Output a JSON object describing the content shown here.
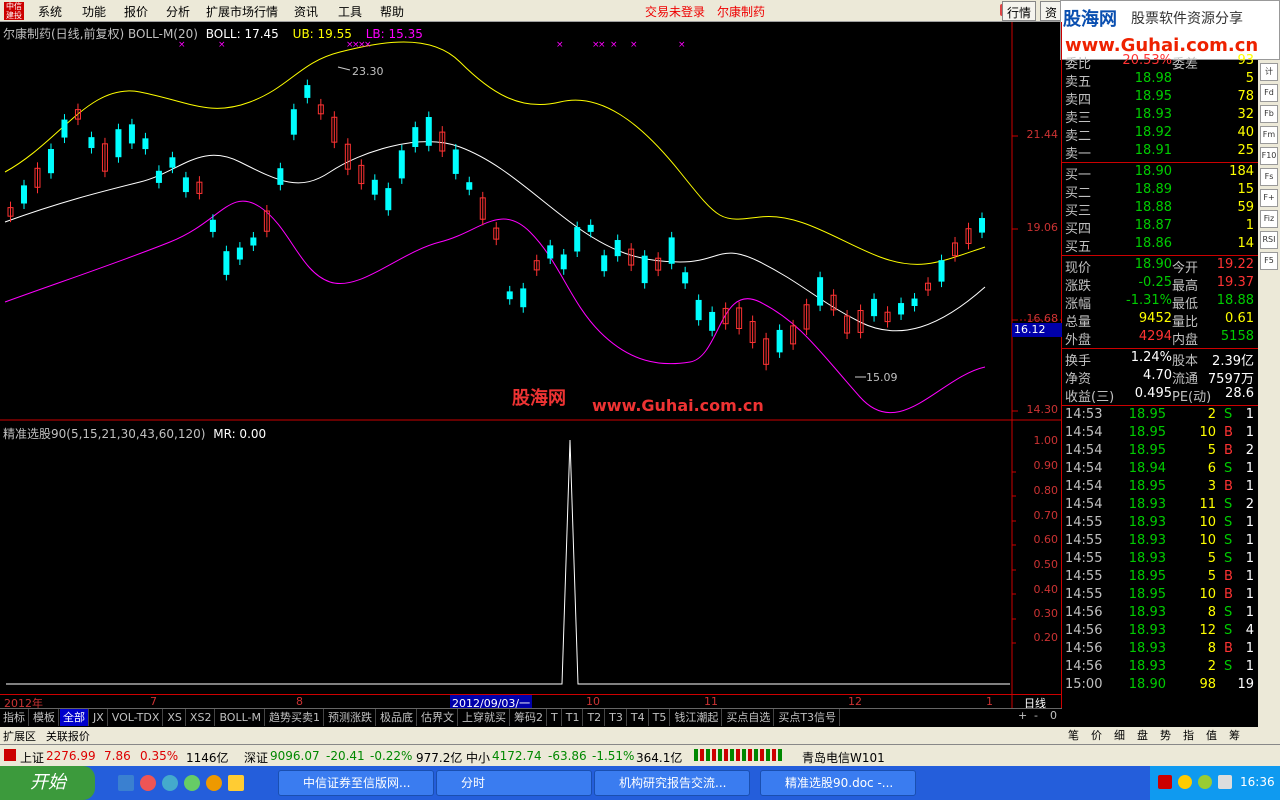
{
  "menu": {
    "items": [
      "系统",
      "功能",
      "报价",
      "分析",
      "扩展市场行情",
      "资讯",
      "工具",
      "帮助"
    ],
    "status_login": "交易未登录",
    "status_stock": "尔康制药",
    "btn_trade": "行情",
    "btn_info": "资"
  },
  "brand": {
    "line1": "股海网",
    "line2": "股票软件资源分享",
    "line3": "www.Guhai.com.cn"
  },
  "chart": {
    "info_title": "尔康制药(日线,前复权) BOLL-M(20)",
    "boll": "BOLL: 17.45",
    "ub": "UB: 19.55",
    "lb": "LB: 15.35",
    "price_ticks": [
      "21.44",
      "19.06",
      "16.68",
      "14.30"
    ],
    "current_tag": "16.12",
    "high_label": "23.30",
    "low_label": "15.09",
    "watermark_cn": "股海网",
    "watermark_url": "www.Guhai.com.cn",
    "ind_title": "精准选股90(5,15,21,30,43,60,120)",
    "ind_mr": "MR: 0.00",
    "ind_ticks": [
      "1.00",
      "0.90",
      "0.80",
      "0.70",
      "0.60",
      "0.50",
      "0.40",
      "0.30",
      "0.20"
    ],
    "date_labels": [
      "2012年",
      "7",
      "8",
      "2012/09/03/一",
      "10",
      "11",
      "12",
      "1"
    ],
    "period": "日线",
    "colors": {
      "up": "#ff3333",
      "down": "#00ffff",
      "ub": "#ffff00",
      "mid": "#ffffff",
      "lb": "#ff00ff",
      "signal": "#ffffff"
    }
  },
  "tabs": [
    "指标",
    "模板",
    "全部",
    "JX",
    "VOL-TDX",
    "XS",
    "XS2",
    "BOLL-M",
    "趋势买卖1",
    "预测涨跌",
    "极品底",
    "估界文",
    "上穿就买",
    "筹码2",
    "T",
    "T1",
    "T2",
    "T3",
    "T4",
    "T5",
    "钱江潮起",
    "买点自选",
    "买点T3信号"
  ],
  "subtabs": [
    "扩展区",
    "关联报价"
  ],
  "zoom": [
    "+",
    "-",
    "0"
  ],
  "quote": {
    "wei_bi_label": "委比",
    "wei_bi": "20.53%",
    "wei_cha_label": "委差",
    "wei_cha": "93",
    "sells": [
      {
        "l": "卖五",
        "p": "18.98",
        "v": "5"
      },
      {
        "l": "卖四",
        "p": "18.95",
        "v": "78"
      },
      {
        "l": "卖三",
        "p": "18.93",
        "v": "32"
      },
      {
        "l": "卖二",
        "p": "18.92",
        "v": "40"
      },
      {
        "l": "卖一",
        "p": "18.91",
        "v": "25"
      }
    ],
    "buys": [
      {
        "l": "买一",
        "p": "18.90",
        "v": "184"
      },
      {
        "l": "买二",
        "p": "18.89",
        "v": "15"
      },
      {
        "l": "买三",
        "p": "18.88",
        "v": "59"
      },
      {
        "l": "买四",
        "p": "18.87",
        "v": "1"
      },
      {
        "l": "买五",
        "p": "18.86",
        "v": "14"
      }
    ],
    "stats": [
      {
        "l1": "现价",
        "v1": "18.90",
        "l2": "今开",
        "v2": "19.22"
      },
      {
        "l1": "涨跌",
        "v1": "-0.25",
        "l2": "最高",
        "v2": "19.37"
      },
      {
        "l1": "涨幅",
        "v1": "-1.31%",
        "l2": "最低",
        "v2": "18.88"
      },
      {
        "l1": "总量",
        "v1": "9452",
        "l2": "量比",
        "v2": "0.61"
      },
      {
        "l1": "外盘",
        "v1": "4294",
        "l2": "内盘",
        "v2": "5158"
      }
    ],
    "stats2": [
      {
        "l1": "换手",
        "v1": "1.24%",
        "l2": "股本",
        "v2": "2.39亿"
      },
      {
        "l1": "净资",
        "v1": "4.70",
        "l2": "流通",
        "v2": "7597万"
      },
      {
        "l1": "收益(三)",
        "v1": "0.495",
        "l2": "PE(动)",
        "v2": "28.6"
      }
    ]
  },
  "ticks": [
    {
      "t": "14:53",
      "p": "18.95",
      "v": "2",
      "s": "S",
      "n": "1"
    },
    {
      "t": "14:54",
      "p": "18.95",
      "v": "10",
      "s": "B",
      "n": "1"
    },
    {
      "t": "14:54",
      "p": "18.95",
      "v": "5",
      "s": "B",
      "n": "2"
    },
    {
      "t": "14:54",
      "p": "18.94",
      "v": "6",
      "s": "S",
      "n": "1"
    },
    {
      "t": "14:54",
      "p": "18.95",
      "v": "3",
      "s": "B",
      "n": "1"
    },
    {
      "t": "14:54",
      "p": "18.93",
      "v": "11",
      "s": "S",
      "n": "2"
    },
    {
      "t": "14:55",
      "p": "18.93",
      "v": "10",
      "s": "S",
      "n": "1"
    },
    {
      "t": "14:55",
      "p": "18.93",
      "v": "10",
      "s": "S",
      "n": "1"
    },
    {
      "t": "14:55",
      "p": "18.93",
      "v": "5",
      "s": "S",
      "n": "1"
    },
    {
      "t": "14:55",
      "p": "18.95",
      "v": "5",
      "s": "B",
      "n": "1"
    },
    {
      "t": "14:55",
      "p": "18.95",
      "v": "10",
      "s": "B",
      "n": "1"
    },
    {
      "t": "14:56",
      "p": "18.93",
      "v": "8",
      "s": "S",
      "n": "1"
    },
    {
      "t": "14:56",
      "p": "18.93",
      "v": "12",
      "s": "S",
      "n": "4"
    },
    {
      "t": "14:56",
      "p": "18.93",
      "v": "8",
      "s": "B",
      "n": "1"
    },
    {
      "t": "14:56",
      "p": "18.93",
      "v": "2",
      "s": "S",
      "n": "1"
    },
    {
      "t": "15:00",
      "p": "18.90",
      "v": "98",
      "s": "",
      "n": "19"
    }
  ],
  "bottomtabs": [
    "笔",
    "价",
    "细",
    "盘",
    "势",
    "指",
    "值",
    "筹"
  ],
  "toolicons": [
    "计",
    "Fd",
    "Fb",
    "Fm",
    "F10",
    "Fs",
    "F+",
    "Fiz",
    "RSI",
    "F5"
  ],
  "indexbar": {
    "sh_name": "上证",
    "sh_val": "2276.99",
    "sh_chg": "7.86",
    "sh_pct": "0.35%",
    "sh_amt": "1146亿",
    "sz_name": "深证",
    "sz_val": "9096.07",
    "sz_chg": "-20.41",
    "sz_pct": "-0.22%",
    "sz_amt": "977.2亿",
    "zx_name": "中小",
    "zx_val": "4172.74",
    "zx_chg": "-63.86",
    "zx_pct": "-1.51%",
    "zx_amt": "364.1亿",
    "news": "青岛电信W101"
  },
  "taskbar": {
    "start": "开始",
    "tasks": [
      "中信证券至信版网...",
      "分时",
      "机构研究报告交流...",
      "精准选股90.doc -..."
    ],
    "clock": "16:36"
  }
}
